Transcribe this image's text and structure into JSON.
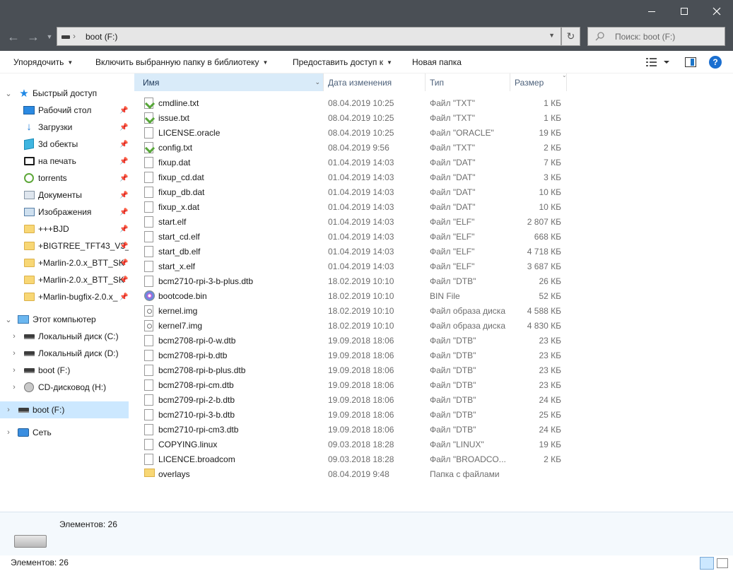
{
  "window": {
    "controls": [
      "minimize",
      "maximize",
      "close"
    ]
  },
  "address": {
    "path_label": "boot (F:)",
    "search_placeholder": "Поиск: boot (F:)"
  },
  "toolbar": {
    "organize": "Упорядочить",
    "include": "Включить выбранную папку в библиотеку",
    "share": "Предоставить доступ к",
    "new_folder": "Новая папка"
  },
  "nav": {
    "quick_access": "Быстрый доступ",
    "items": [
      {
        "label": "Рабочий стол",
        "icon": "desktop-icon",
        "pinned": true
      },
      {
        "label": "Загрузки",
        "icon": "download-icon",
        "pinned": true
      },
      {
        "label": "3d обекты",
        "icon": "3d-objects-icon",
        "pinned": true
      },
      {
        "label": "на печать",
        "icon": "print-icon",
        "pinned": true
      },
      {
        "label": "torrents",
        "icon": "torrent-icon",
        "pinned": true
      },
      {
        "label": "Документы",
        "icon": "documents-icon",
        "pinned": true
      },
      {
        "label": "Изображения",
        "icon": "pictures-icon",
        "pinned": true
      },
      {
        "label": "+++BJD",
        "icon": "folder-icon",
        "pinned": true
      },
      {
        "label": "+BIGTREE_TFT43_V3_(",
        "icon": "folder-icon",
        "pinned": true
      },
      {
        "label": "+Marlin-2.0.x_BTT_SK",
        "icon": "folder-icon",
        "pinned": true
      },
      {
        "label": "+Marlin-2.0.x_BTT_SK",
        "icon": "folder-icon",
        "pinned": true
      },
      {
        "label": "+Marlin-bugfix-2.0.x_",
        "icon": "folder-icon",
        "pinned": true
      }
    ],
    "this_pc": "Этот компьютер",
    "drives": [
      {
        "label": "Локальный диск (C:)",
        "icon": "drive-icon"
      },
      {
        "label": "Локальный диск (D:)",
        "icon": "drive-icon"
      },
      {
        "label": "boot (F:)",
        "icon": "drive-icon"
      },
      {
        "label": "CD-дисковод (H:)",
        "icon": "cd-drive-icon"
      }
    ],
    "selected_drive": "boot (F:)",
    "network": "Сеть"
  },
  "columns": {
    "name": "Имя",
    "date": "Дата изменения",
    "type": "Тип",
    "size": "Размер"
  },
  "files": [
    {
      "name": "cmdline.txt",
      "date": "08.04.2019 10:25",
      "type": "Файл \"TXT\"",
      "size": "1 КБ",
      "icon": "txt"
    },
    {
      "name": "issue.txt",
      "date": "08.04.2019 10:25",
      "type": "Файл \"TXT\"",
      "size": "1 КБ",
      "icon": "txt"
    },
    {
      "name": "LICENSE.oracle",
      "date": "08.04.2019 10:25",
      "type": "Файл \"ORACLE\"",
      "size": "19 КБ",
      "icon": "doc"
    },
    {
      "name": "config.txt",
      "date": "08.04.2019 9:56",
      "type": "Файл \"TXT\"",
      "size": "2 КБ",
      "icon": "txt"
    },
    {
      "name": "fixup.dat",
      "date": "01.04.2019 14:03",
      "type": "Файл \"DAT\"",
      "size": "7 КБ",
      "icon": "doc"
    },
    {
      "name": "fixup_cd.dat",
      "date": "01.04.2019 14:03",
      "type": "Файл \"DAT\"",
      "size": "3 КБ",
      "icon": "doc"
    },
    {
      "name": "fixup_db.dat",
      "date": "01.04.2019 14:03",
      "type": "Файл \"DAT\"",
      "size": "10 КБ",
      "icon": "doc"
    },
    {
      "name": "fixup_x.dat",
      "date": "01.04.2019 14:03",
      "type": "Файл \"DAT\"",
      "size": "10 КБ",
      "icon": "doc"
    },
    {
      "name": "start.elf",
      "date": "01.04.2019 14:03",
      "type": "Файл \"ELF\"",
      "size": "2 807 КБ",
      "icon": "doc"
    },
    {
      "name": "start_cd.elf",
      "date": "01.04.2019 14:03",
      "type": "Файл \"ELF\"",
      "size": "668 КБ",
      "icon": "doc"
    },
    {
      "name": "start_db.elf",
      "date": "01.04.2019 14:03",
      "type": "Файл \"ELF\"",
      "size": "4 718 КБ",
      "icon": "doc"
    },
    {
      "name": "start_x.elf",
      "date": "01.04.2019 14:03",
      "type": "Файл \"ELF\"",
      "size": "3 687 КБ",
      "icon": "doc"
    },
    {
      "name": "bcm2710-rpi-3-b-plus.dtb",
      "date": "18.02.2019 10:10",
      "type": "Файл \"DTB\"",
      "size": "26 КБ",
      "icon": "doc"
    },
    {
      "name": "bootcode.bin",
      "date": "18.02.2019 10:10",
      "type": "BIN File",
      "size": "52 КБ",
      "icon": "bin"
    },
    {
      "name": "kernel.img",
      "date": "18.02.2019 10:10",
      "type": "Файл образа диска",
      "size": "4 588 КБ",
      "icon": "img"
    },
    {
      "name": "kernel7.img",
      "date": "18.02.2019 10:10",
      "type": "Файл образа диска",
      "size": "4 830 КБ",
      "icon": "img"
    },
    {
      "name": "bcm2708-rpi-0-w.dtb",
      "date": "19.09.2018 18:06",
      "type": "Файл \"DTB\"",
      "size": "23 КБ",
      "icon": "doc"
    },
    {
      "name": "bcm2708-rpi-b.dtb",
      "date": "19.09.2018 18:06",
      "type": "Файл \"DTB\"",
      "size": "23 КБ",
      "icon": "doc"
    },
    {
      "name": "bcm2708-rpi-b-plus.dtb",
      "date": "19.09.2018 18:06",
      "type": "Файл \"DTB\"",
      "size": "23 КБ",
      "icon": "doc"
    },
    {
      "name": "bcm2708-rpi-cm.dtb",
      "date": "19.09.2018 18:06",
      "type": "Файл \"DTB\"",
      "size": "23 КБ",
      "icon": "doc"
    },
    {
      "name": "bcm2709-rpi-2-b.dtb",
      "date": "19.09.2018 18:06",
      "type": "Файл \"DTB\"",
      "size": "24 КБ",
      "icon": "doc"
    },
    {
      "name": "bcm2710-rpi-3-b.dtb",
      "date": "19.09.2018 18:06",
      "type": "Файл \"DTB\"",
      "size": "25 КБ",
      "icon": "doc"
    },
    {
      "name": "bcm2710-rpi-cm3.dtb",
      "date": "19.09.2018 18:06",
      "type": "Файл \"DTB\"",
      "size": "24 КБ",
      "icon": "doc"
    },
    {
      "name": "COPYING.linux",
      "date": "09.03.2018 18:28",
      "type": "Файл \"LINUX\"",
      "size": "19 КБ",
      "icon": "doc"
    },
    {
      "name": "LICENCE.broadcom",
      "date": "09.03.2018 18:28",
      "type": "Файл \"BROADCO...",
      "size": "2 КБ",
      "icon": "doc"
    },
    {
      "name": "overlays",
      "date": "08.04.2019 9:48",
      "type": "Папка с файлами",
      "size": "",
      "icon": "folder"
    }
  ],
  "details": {
    "count_label": "Элементов: 26"
  },
  "status": {
    "count_label": "Элементов: 26"
  }
}
